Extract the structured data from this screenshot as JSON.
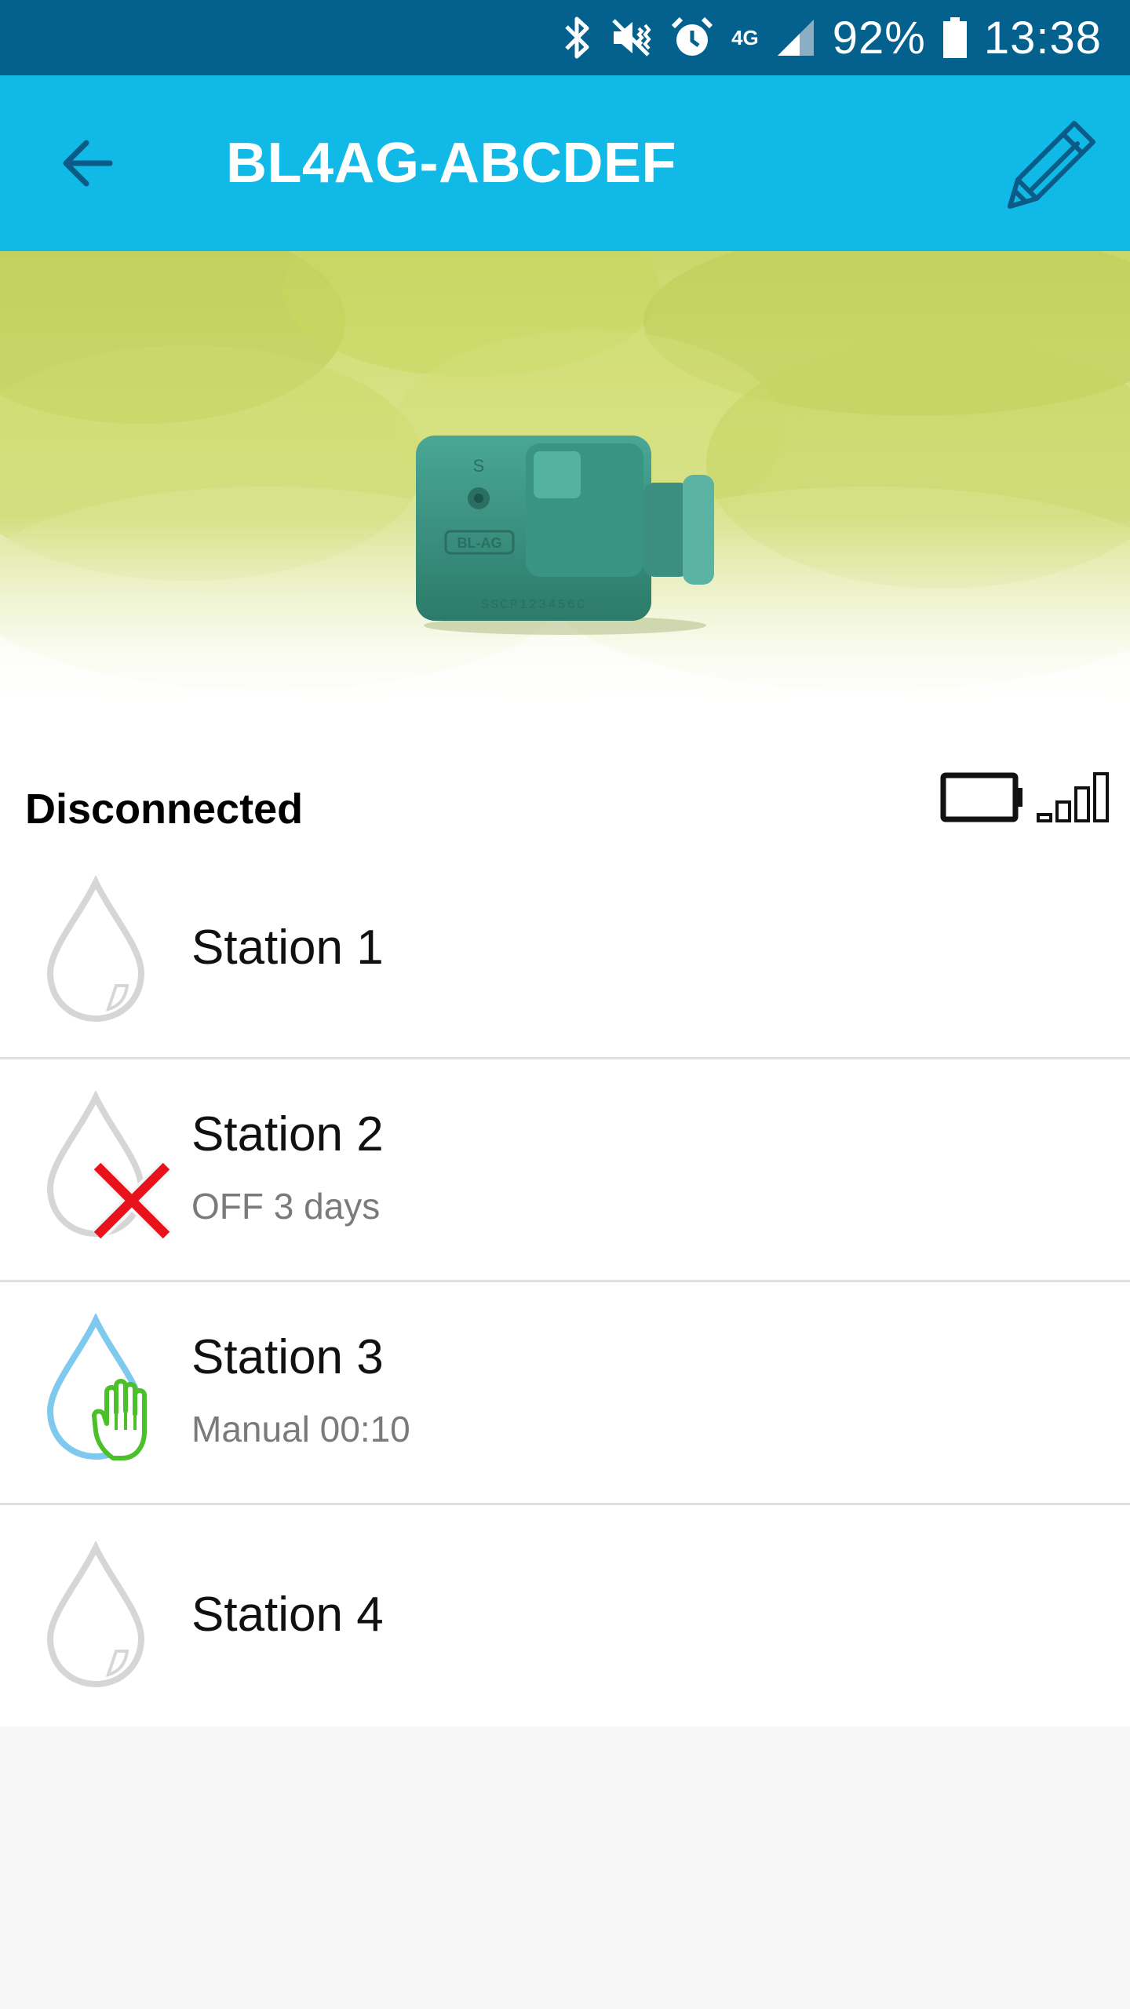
{
  "status_bar": {
    "network": "4G",
    "battery": "92%",
    "time": "13:38",
    "icons": [
      "bluetooth-icon",
      "vibrate-mute-icon",
      "alarm-icon",
      "network-4g-icon",
      "signal-icon",
      "battery-icon"
    ]
  },
  "app_bar": {
    "title": "BL4AG-ABCDEF",
    "back_icon": "arrow-left-icon",
    "edit_icon": "pencil-icon",
    "background_color": "#11b9e6"
  },
  "device": {
    "model_label": "BL-AG",
    "serial_label": "SSCP123456C"
  },
  "connection": {
    "status": "Disconnected"
  },
  "stations": [
    {
      "name": "Station 1",
      "subtitle": "",
      "state": "idle",
      "icon": "water-drop-icon"
    },
    {
      "name": "Station 2",
      "subtitle": "OFF 3 days",
      "state": "off",
      "icon": "water-drop-off-icon"
    },
    {
      "name": "Station 3",
      "subtitle": "Manual 00:10",
      "state": "manual",
      "icon": "water-drop-manual-icon"
    },
    {
      "name": "Station 4",
      "subtitle": "",
      "state": "idle",
      "icon": "water-drop-icon"
    }
  ],
  "colors": {
    "status_bar": "#04618d",
    "app_bar": "#11b9e6",
    "drop_idle": "#d6d6d6",
    "drop_active": "#7fc9ee",
    "off_mark": "#e8121c",
    "manual_hand": "#4cc02a"
  }
}
